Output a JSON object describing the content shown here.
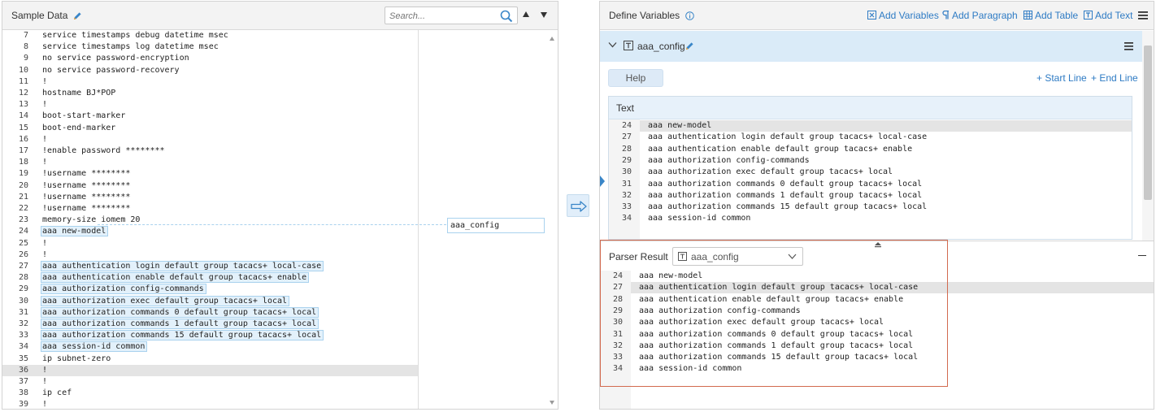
{
  "left": {
    "title": "Sample Data",
    "search_placeholder": "Search...",
    "variable_tag": "aaa_config",
    "lines": [
      {
        "n": "7",
        "t": "service timestamps debug datetime msec"
      },
      {
        "n": "8",
        "t": "service timestamps log datetime msec"
      },
      {
        "n": "9",
        "t": "no service password-encryption"
      },
      {
        "n": "10",
        "t": "no service password-recovery"
      },
      {
        "n": "11",
        "t": "!"
      },
      {
        "n": "12",
        "t": "hostname BJ*POP"
      },
      {
        "n": "13",
        "t": "!"
      },
      {
        "n": "14",
        "t": "boot-start-marker"
      },
      {
        "n": "15",
        "t": "boot-end-marker"
      },
      {
        "n": "16",
        "t": "!"
      },
      {
        "n": "17",
        "t": "!enable password ********"
      },
      {
        "n": "18",
        "t": "!"
      },
      {
        "n": "19",
        "t": "!username ********"
      },
      {
        "n": "20",
        "t": "!username ********"
      },
      {
        "n": "21",
        "t": "!username ********"
      },
      {
        "n": "22",
        "t": "!username ********"
      },
      {
        "n": "23",
        "t": "memory-size iomem 20"
      },
      {
        "n": "24",
        "t": "aaa new-model",
        "hl": true
      },
      {
        "n": "25",
        "t": "!"
      },
      {
        "n": "26",
        "t": "!"
      },
      {
        "n": "27",
        "t": "aaa authentication login default group tacacs+ local-case",
        "hl": true
      },
      {
        "n": "28",
        "t": "aaa authentication enable default group tacacs+ enable",
        "hl": true
      },
      {
        "n": "29",
        "t": "aaa authorization config-commands",
        "hl": true
      },
      {
        "n": "30",
        "t": "aaa authorization exec default group tacacs+ local",
        "hl": true
      },
      {
        "n": "31",
        "t": "aaa authorization commands 0 default group tacacs+ local",
        "hl": true
      },
      {
        "n": "32",
        "t": "aaa authorization commands 1 default group tacacs+ local",
        "hl": true
      },
      {
        "n": "33",
        "t": "aaa authorization commands 15 default group tacacs+ local",
        "hl": true
      },
      {
        "n": "34",
        "t": "aaa session-id common",
        "hl": true
      },
      {
        "n": "35",
        "t": "ip subnet-zero"
      },
      {
        "n": "36",
        "t": "!",
        "cursor": true
      },
      {
        "n": "37",
        "t": "!"
      },
      {
        "n": "38",
        "t": "ip cef"
      },
      {
        "n": "39",
        "t": "!"
      }
    ]
  },
  "right": {
    "title": "Define Variables",
    "actions": {
      "add_variables": "Add Variables",
      "add_paragraph": "Add Paragraph",
      "add_table": "Add Table",
      "add_text": "Add Text"
    },
    "variable": {
      "name": "aaa_config"
    },
    "help_label": "Help",
    "start_line": "+ Start Line",
    "end_line": "+ End Line",
    "text_title": "Text",
    "text_lines": [
      {
        "n": "24",
        "t": "aaa new-model",
        "cursor": true
      },
      {
        "n": "27",
        "t": "aaa authentication login default group tacacs+ local-case"
      },
      {
        "n": "28",
        "t": "aaa authentication enable default group tacacs+ enable"
      },
      {
        "n": "29",
        "t": "aaa authorization config-commands"
      },
      {
        "n": "30",
        "t": "aaa authorization exec default group tacacs+ local"
      },
      {
        "n": "31",
        "t": "aaa authorization commands 0 default group tacacs+ local"
      },
      {
        "n": "32",
        "t": "aaa authorization commands 1 default group tacacs+ local"
      },
      {
        "n": "33",
        "t": "aaa authorization commands 15 default group tacacs+ local"
      },
      {
        "n": "34",
        "t": "aaa session-id common"
      }
    ],
    "parser_title": "Parser Result",
    "parser_selected": "aaa_config",
    "parser_lines": [
      {
        "n": "24",
        "t": "aaa new-model"
      },
      {
        "n": "27",
        "t": "aaa authentication login default group tacacs+ local-case",
        "cursor": true
      },
      {
        "n": "28",
        "t": "aaa authentication enable default group tacacs+ enable"
      },
      {
        "n": "29",
        "t": "aaa authorization config-commands"
      },
      {
        "n": "30",
        "t": "aaa authorization exec default group tacacs+ local"
      },
      {
        "n": "31",
        "t": "aaa authorization commands 0 default group tacacs+ local"
      },
      {
        "n": "32",
        "t": "aaa authorization commands 1 default group tacacs+ local"
      },
      {
        "n": "33",
        "t": "aaa authorization commands 15 default group tacacs+ local"
      },
      {
        "n": "34",
        "t": "aaa session-id common"
      }
    ]
  },
  "colors": {
    "accent": "#2e7bc4",
    "selection_bg": "#e3f1fb",
    "selection_border": "#a9d2ee",
    "variable_bar": "#daebf8",
    "parser_border": "#d26a4f",
    "cursor_line": "#e4e4e4"
  }
}
